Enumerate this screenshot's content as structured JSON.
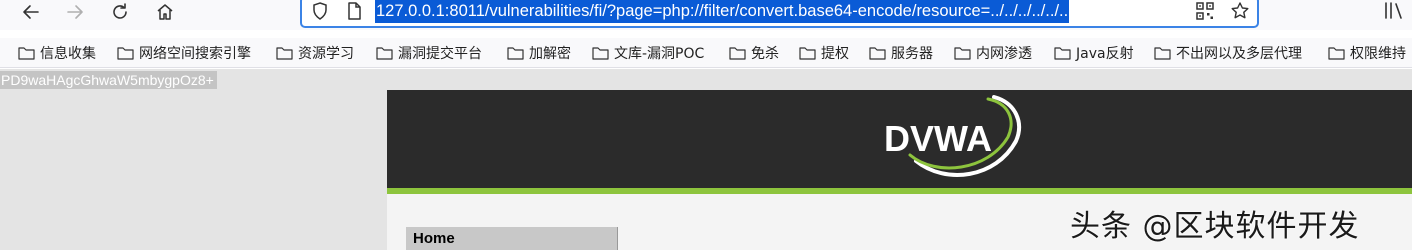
{
  "toolbar": {
    "url": "127.0.0.1:8011/vulnerabilities/fi/?page=php://filter/convert.base64-encode/resource=../../../../../.."
  },
  "bookmarks": [
    {
      "label": "信息收集"
    },
    {
      "label": "网络空间搜索引擎"
    },
    {
      "label": "资源学习"
    },
    {
      "label": "漏洞提交平台"
    },
    {
      "label": "加解密"
    },
    {
      "label": "文库-漏洞POC"
    },
    {
      "label": "免杀"
    },
    {
      "label": "提权"
    },
    {
      "label": "服务器"
    },
    {
      "label": "内网渗透"
    },
    {
      "label": "Java反射"
    },
    {
      "label": "不出网以及多层代理"
    },
    {
      "label": "权限维持"
    }
  ],
  "page": {
    "output_text": "PD9waHAgcGhwaW5mbygpOz8+",
    "logo_text": "DVWA",
    "menu": {
      "home_label": "Home"
    },
    "watermark": "头条 @区块软件开发"
  },
  "colors": {
    "url_highlight": "#0a5bd6",
    "dvwa_header": "#2b2b2b",
    "dvwa_accent": "#8dc43d"
  }
}
